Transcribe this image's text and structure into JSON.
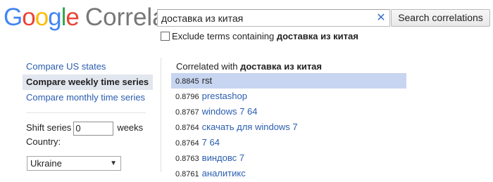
{
  "logo": {
    "word1_letters": [
      {
        "char": "G",
        "color": "#4285f4"
      },
      {
        "char": "o",
        "color": "#ea4335"
      },
      {
        "char": "o",
        "color": "#fbbc05"
      },
      {
        "char": "g",
        "color": "#4285f4"
      },
      {
        "char": "l",
        "color": "#34a853"
      },
      {
        "char": "e",
        "color": "#ea4335"
      }
    ],
    "word2": "Correlate"
  },
  "search": {
    "value": "доставка из китая",
    "clear_icon": "close-icon",
    "button_label": "Search correlations"
  },
  "exclude": {
    "prefix": "Exclude terms containing",
    "term": "доставка из китая",
    "checked": false
  },
  "sidebar": {
    "items": [
      {
        "label": "Compare US states",
        "active": false
      },
      {
        "label": "Compare weekly time series",
        "active": true
      },
      {
        "label": "Compare monthly time series",
        "active": false
      }
    ],
    "shift_label": "Shift series",
    "shift_value": "0",
    "shift_unit": "weeks",
    "country_label": "Country:",
    "country_value": "Ukraine"
  },
  "results": {
    "header_prefix": "Correlated with",
    "header_term": "доставка из китая",
    "rows": [
      {
        "score": "0.8845",
        "term": "rst",
        "selected": true
      },
      {
        "score": "0.8796",
        "term": "prestashop",
        "selected": false
      },
      {
        "score": "0.8767",
        "term": "windows 7 64",
        "selected": false
      },
      {
        "score": "0.8764",
        "term": "скачать для windows 7",
        "selected": false
      },
      {
        "score": "0.8764",
        "term": "7 64",
        "selected": false
      },
      {
        "score": "0.8763",
        "term": "виндовс 7",
        "selected": false
      },
      {
        "score": "0.8761",
        "term": "аналитикс",
        "selected": false
      }
    ]
  }
}
